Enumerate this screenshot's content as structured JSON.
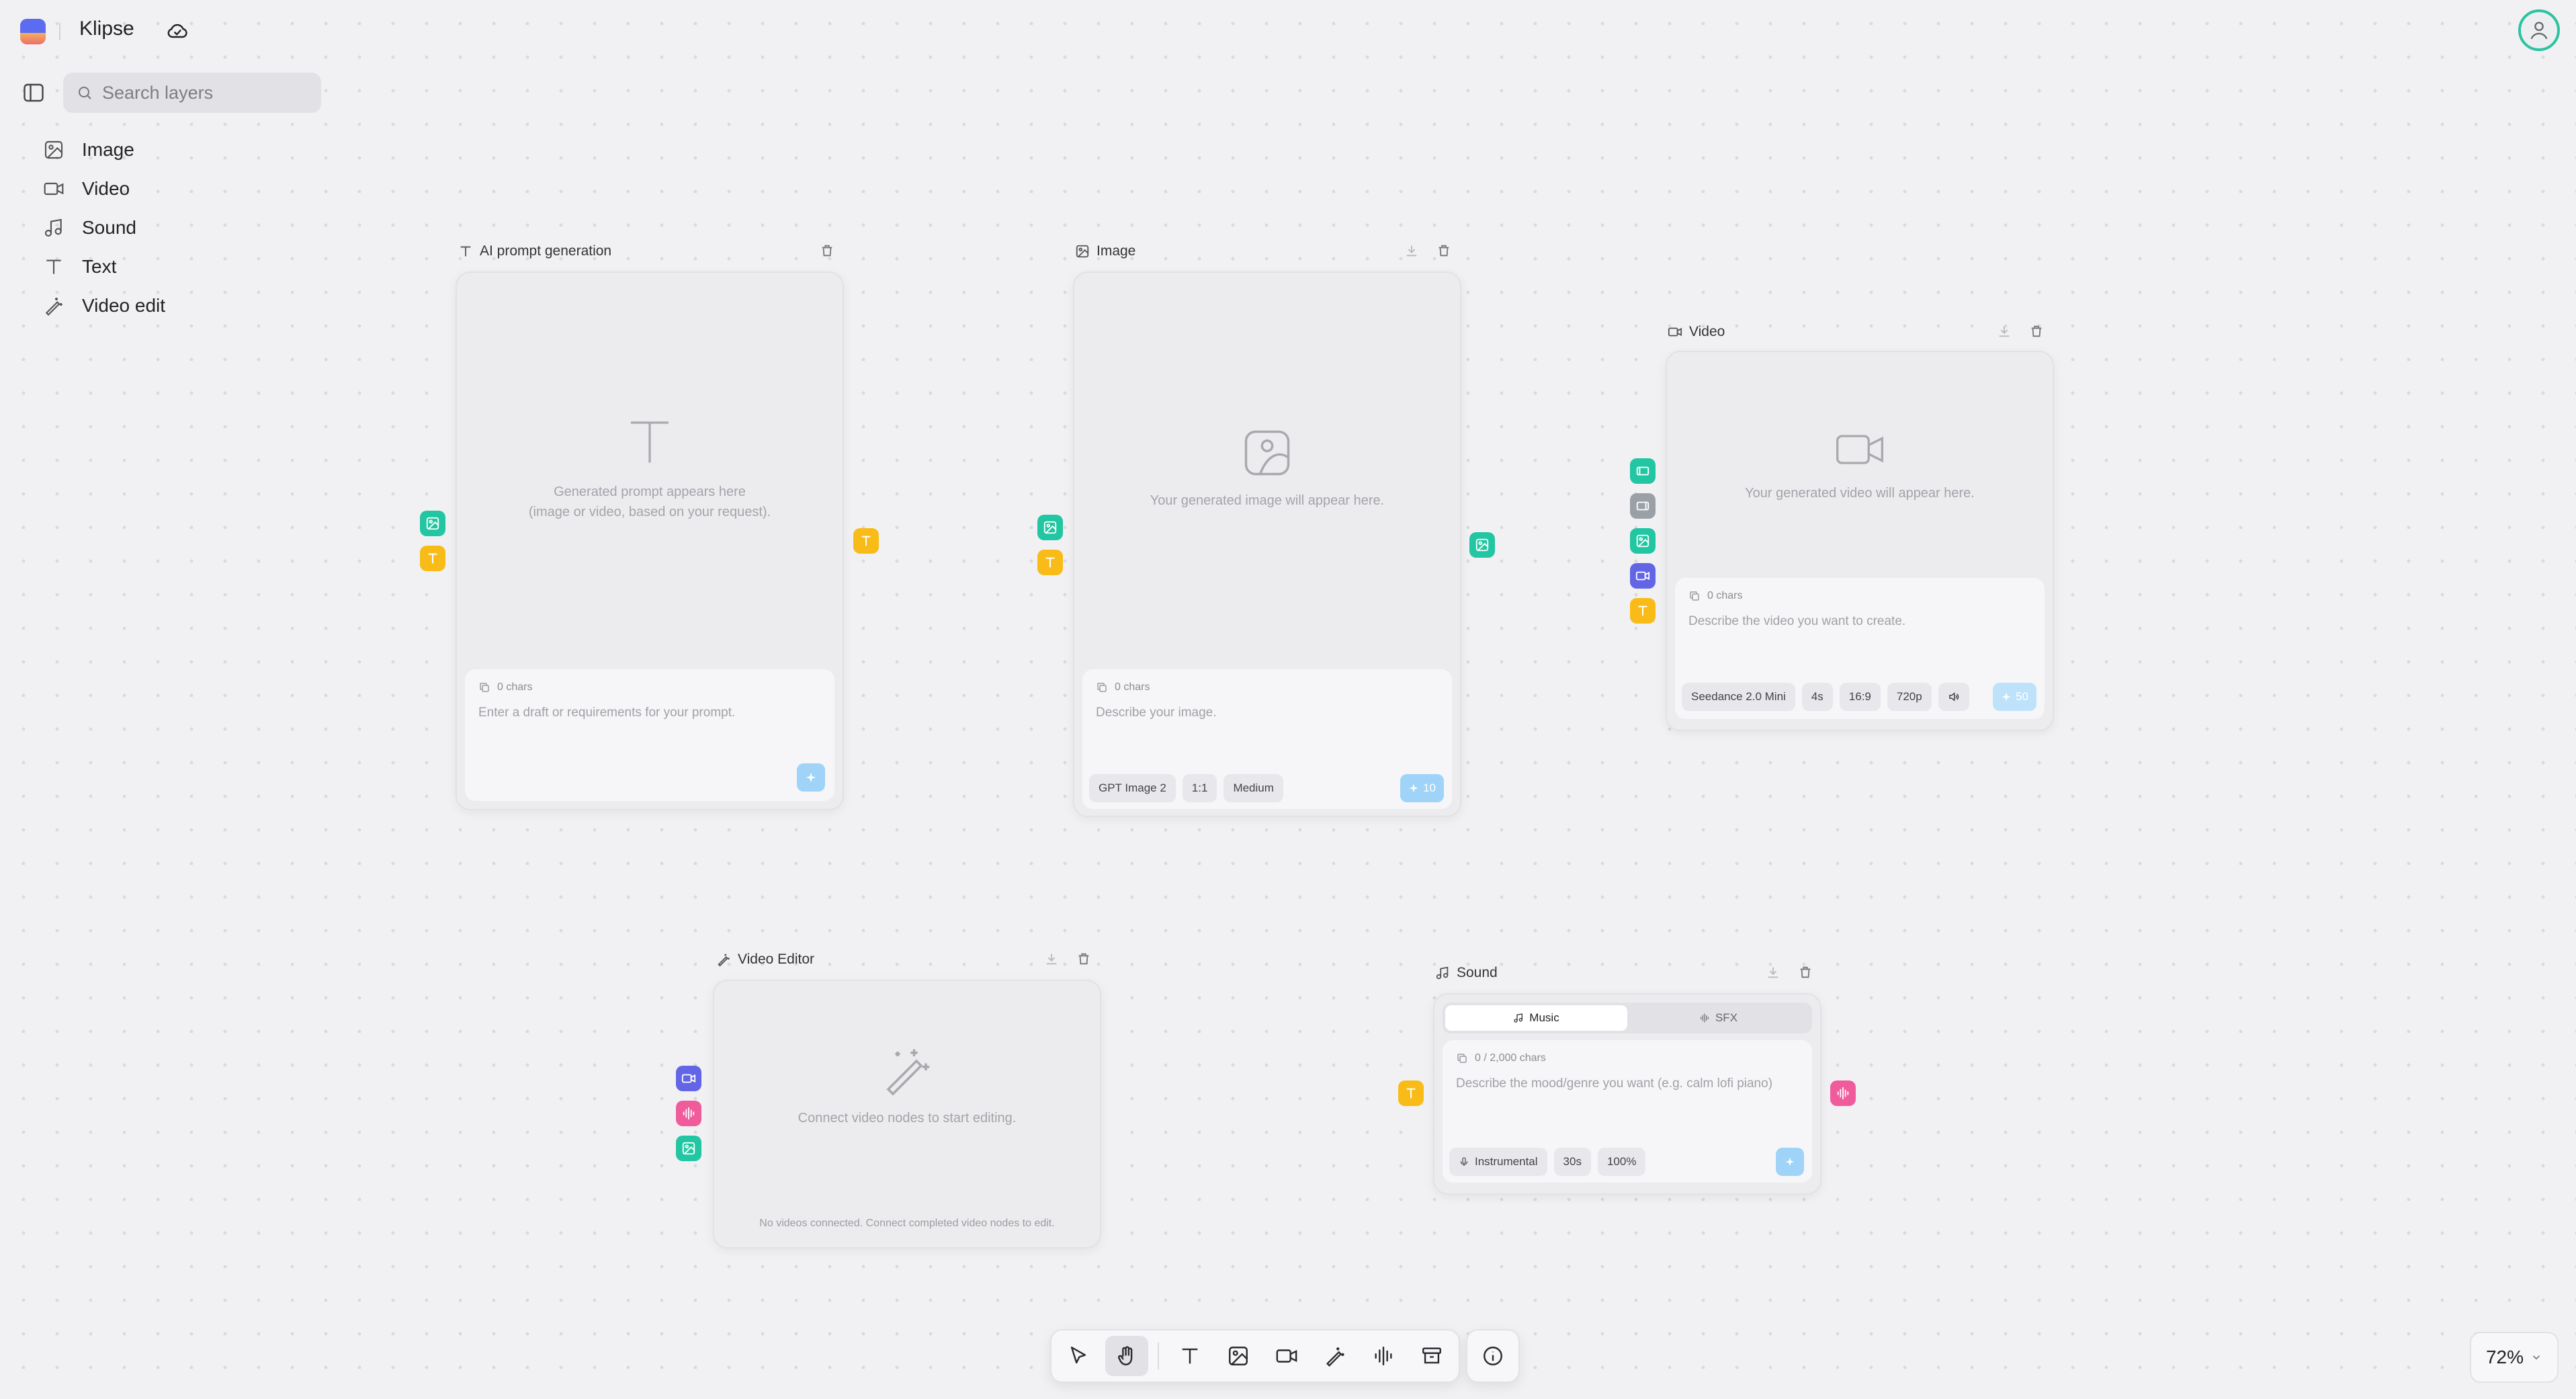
{
  "app": {
    "title": "Klipse"
  },
  "search": {
    "placeholder": "Search layers"
  },
  "layers": [
    {
      "label": "Image",
      "icon": "image-icon"
    },
    {
      "label": "Video",
      "icon": "video-icon"
    },
    {
      "label": "Sound",
      "icon": "music-note-icon"
    },
    {
      "label": "Text",
      "icon": "text-icon"
    },
    {
      "label": "Video edit",
      "icon": "magic-wand-icon"
    }
  ],
  "nodes": {
    "ai_prompt": {
      "title": "AI prompt generation",
      "placeholder_line1": "Generated prompt appears here",
      "placeholder_line2": "(image or video, based on your request).",
      "chars": "0 chars",
      "input_placeholder": "Enter a draft or requirements for your prompt."
    },
    "image": {
      "title": "Image",
      "placeholder": "Your generated image will appear here.",
      "chars": "0 chars",
      "input_placeholder": "Describe your image.",
      "chips": [
        "GPT Image 2",
        "1:1",
        "Medium"
      ],
      "credits": "10"
    },
    "video": {
      "title": "Video",
      "placeholder": "Your generated video will appear here.",
      "chars": "0 chars",
      "input_placeholder": "Describe the video you want to create.",
      "chips": [
        "Seedance 2.0 Mini",
        "4s",
        "16:9",
        "720p"
      ],
      "credits": "50"
    },
    "video_editor": {
      "title": "Video Editor",
      "placeholder": "Connect video nodes to start editing.",
      "footer": "No videos connected. Connect completed video nodes to edit."
    },
    "sound": {
      "title": "Sound",
      "tabs": [
        "Music",
        "SFX"
      ],
      "chars": "0 / 2,000 chars",
      "input_placeholder": "Describe the mood/genre you want (e.g. calm lofi piano)",
      "chips": [
        "Instrumental",
        "30s",
        "100%"
      ]
    }
  },
  "zoom": {
    "level": "72%"
  },
  "colors": {
    "port_image": "#22c6a2",
    "port_text": "#f9bb17",
    "port_video": "#6165e6",
    "port_audio": "#f05b9c",
    "accent_button": "#9fd3f8",
    "avatar_ring": "#2bc3a0"
  }
}
